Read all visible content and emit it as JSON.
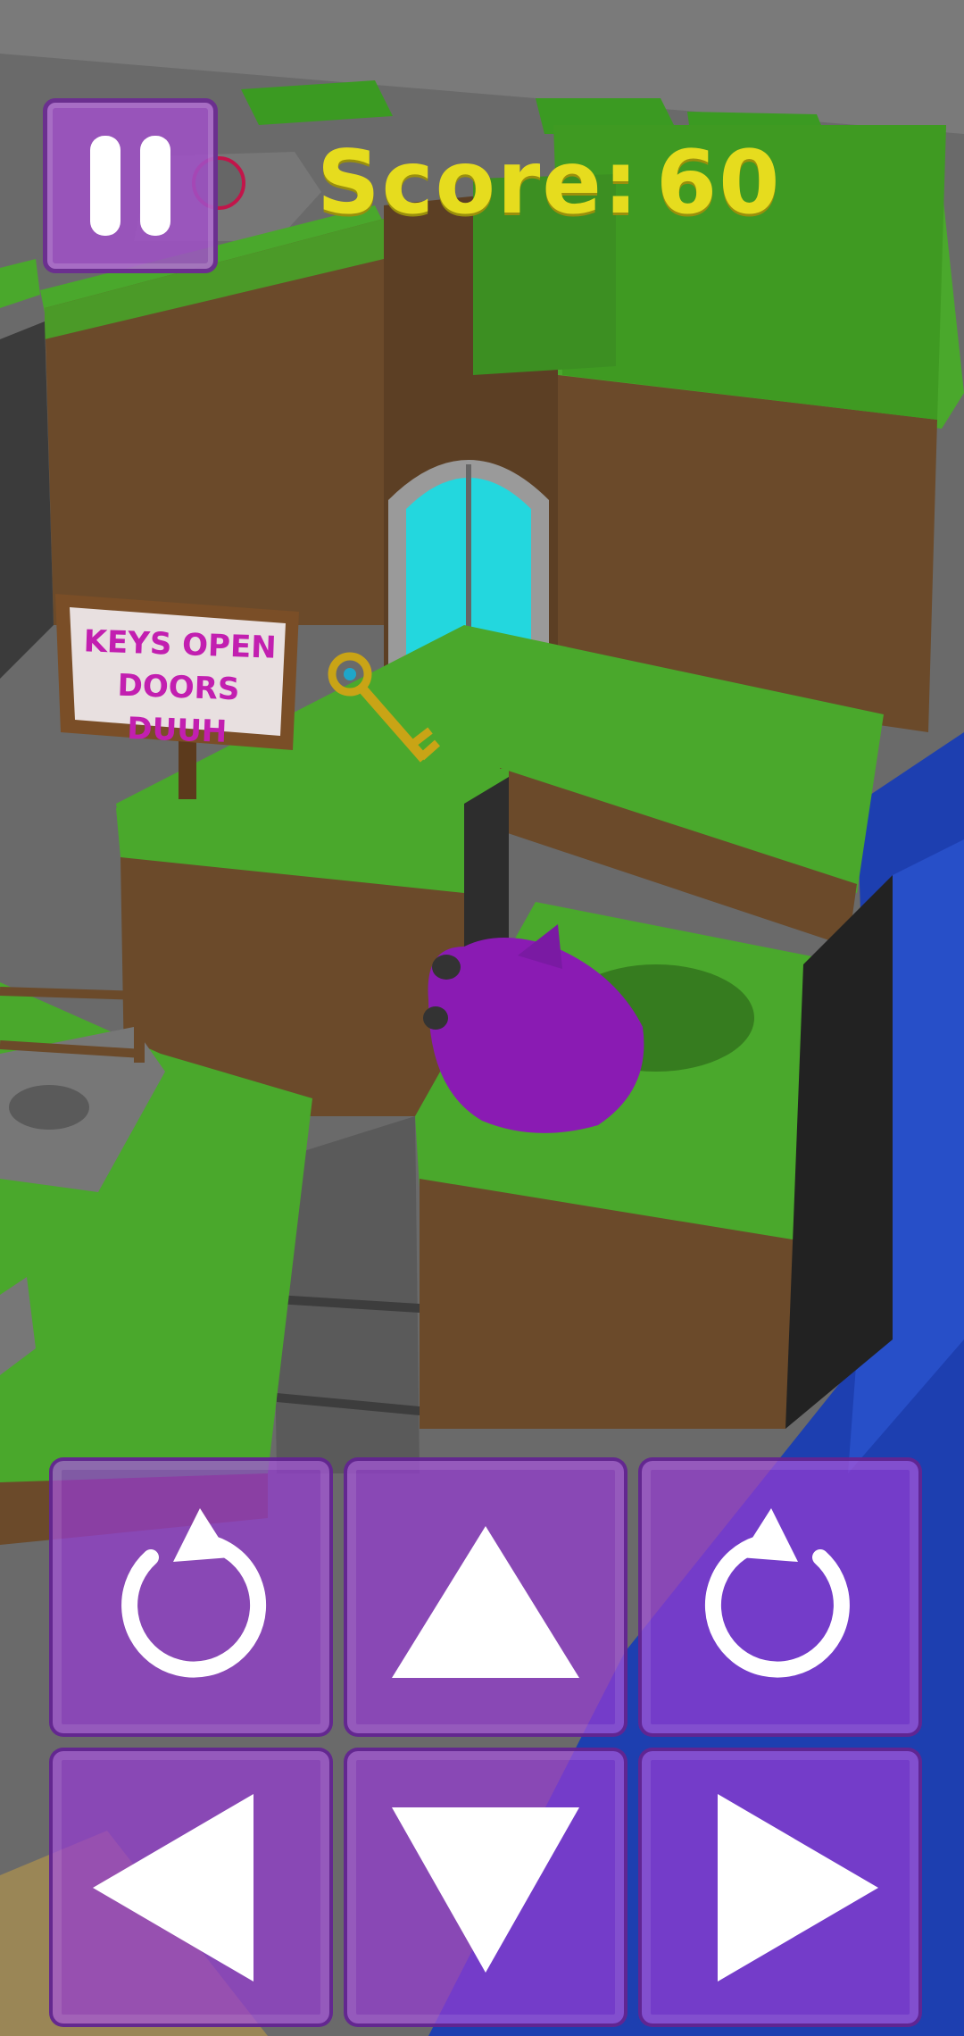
{
  "hud": {
    "score_label": "Score:",
    "score_value": "60",
    "score_color": "#e6dc1e"
  },
  "sign": {
    "line1": "KEYS OPEN",
    "line2": "DOORS DUUH"
  },
  "controls": {
    "rotate_left_icon": "rotate-clockwise-icon",
    "up_icon": "arrow-up-icon",
    "rotate_right_icon": "rotate-counterclockwise-icon",
    "left_icon": "arrow-left-icon",
    "down_icon": "arrow-down-icon",
    "right_icon": "arrow-right-icon",
    "accent": "#9640d2"
  }
}
